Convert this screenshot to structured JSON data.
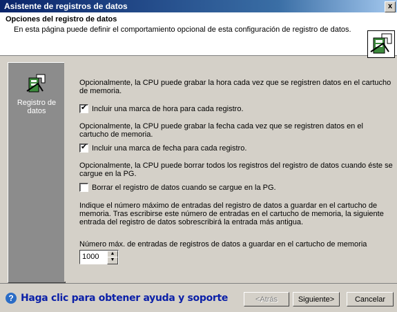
{
  "window": {
    "title": "Asistente de registros de datos",
    "close_label": "x"
  },
  "header": {
    "title": "Opciones del registro de datos",
    "subtitle": "En esta página puede definir el comportamiento opcional de esta configuración de registro de datos.",
    "icon": "data-log-icon"
  },
  "sidebar": {
    "items": [
      {
        "label": "Registro de datos",
        "icon": "data-log-icon"
      }
    ]
  },
  "main": {
    "para_time": "Opcionalmente, la CPU puede grabar la hora cada vez que se registren datos en el cartucho de memoria.",
    "cb_time": {
      "label": "Incluir una marca de hora para cada registro.",
      "checked": true
    },
    "para_date": "Opcionalmente, la CPU puede grabar la fecha cada vez que se registren datos en el cartucho de memoria.",
    "cb_date": {
      "label": "Incluir una marca de fecha para cada registro.",
      "checked": true
    },
    "para_clear": "Opcionalmente, la CPU puede borrar todos los registros del registro de datos cuando éste se cargue en la PG.",
    "cb_clear": {
      "label": "Borrar el registro de datos cuando se cargue en la PG.",
      "checked": false
    },
    "para_max": "Indique el número máximo de entradas del registro de datos a guardar en el cartucho de memoria. Tras escribirse este número de entradas en el cartucho de memoria, la siguiente entrada del registro de datos sobrescribirá la entrada más antigua.",
    "max_label": "Número máx. de entradas de registros de datos a guardar en el cartucho de memoria",
    "max_value": "1000"
  },
  "footer": {
    "help_text": "Haga clic para obtener ayuda y soporte",
    "back_label": "<Atrás",
    "next_label": "Siguiente>",
    "cancel_label": "Cancelar"
  }
}
